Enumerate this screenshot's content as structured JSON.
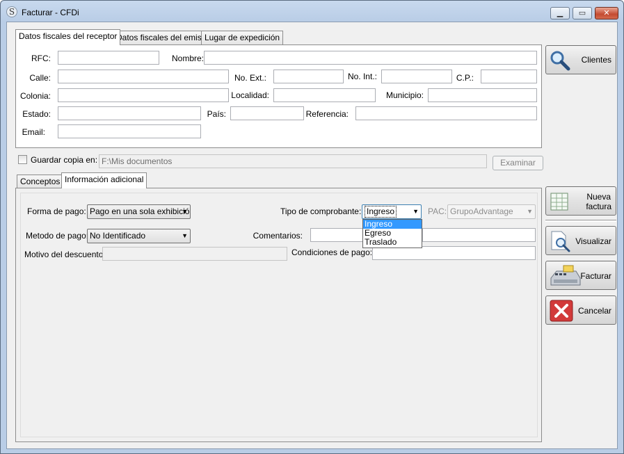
{
  "window": {
    "title": "Facturar - CFDi",
    "app_icon_glyph": "S",
    "controls": {
      "minimize": "▁",
      "maximize": "▭",
      "close": "✕"
    }
  },
  "top_tabs": [
    {
      "label": "Datos fiscales del receptor",
      "active": true
    },
    {
      "label": "Datos fiscales del emisor",
      "active": false
    },
    {
      "label": "Lugar de expedición",
      "active": false
    }
  ],
  "receptor": {
    "rfc_label": "RFC:",
    "rfc_value": "",
    "nombre_label": "Nombre:",
    "nombre_value": "",
    "calle_label": "Calle:",
    "calle_value": "",
    "no_ext_label": "No. Ext.:",
    "no_ext_value": "",
    "no_int_label": "No. Int.:",
    "no_int_value": "",
    "cp_label": "C.P.:",
    "cp_value": "",
    "colonia_label": "Colonia:",
    "colonia_value": "",
    "localidad_label": "Localidad:",
    "localidad_value": "",
    "municipio_label": "Municipio:",
    "municipio_value": "",
    "estado_label": "Estado:",
    "estado_value": "",
    "pais_label": "País:",
    "pais_value": "",
    "referencia_label": "Referencia:",
    "referencia_value": "",
    "email_label": "Email:",
    "email_value": ""
  },
  "guardar": {
    "checkbox_label": "Guardar copia en:",
    "checked": false,
    "path_value": "F:\\Mis documentos",
    "examinar_label": "Examinar"
  },
  "bottom_tabs": [
    {
      "label": "Conceptos",
      "active": false
    },
    {
      "label": "Información adicional",
      "active": true
    }
  ],
  "info": {
    "forma_pago_label": "Forma de pago:",
    "forma_pago_value": "Pago en una sola exhibició",
    "metodo_pago_label": "Metodo de pago:",
    "metodo_pago_value": "No Identificado",
    "motivo_descuento_label": "Motivo del descuento:",
    "motivo_descuento_value": "",
    "tipo_comprobante_label": "Tipo de comprobante:",
    "tipo_comprobante_value": "Ingreso",
    "tipo_comprobante_options": [
      "Ingreso",
      "Egreso",
      "Traslado"
    ],
    "tipo_comprobante_highlighted": "Ingreso",
    "pac_label": "PAC:",
    "pac_value": "GrupoAdvantage",
    "comentarios_label": "Comentarios:",
    "comentarios_value": "",
    "condiciones_pago_label": "Condiciones de pago:",
    "condiciones_pago_value": ""
  },
  "side_buttons": {
    "clientes": {
      "label": "Clientes",
      "icon": "magnifier-icon"
    },
    "nueva_factura": {
      "label_line1": "Nueva",
      "label_line2": "factura",
      "icon": "spreadsheet-icon"
    },
    "visualizar": {
      "label": "Visualizar",
      "icon": "document-preview-icon"
    },
    "facturar": {
      "label": "Facturar",
      "icon": "cash-register-icon"
    },
    "cancelar": {
      "label": "Cancelar",
      "icon": "red-x-icon"
    }
  },
  "colors": {
    "selection": "#3399ff",
    "cancel_red": "#d23a3a",
    "titlebar": "#c8d9ee"
  }
}
